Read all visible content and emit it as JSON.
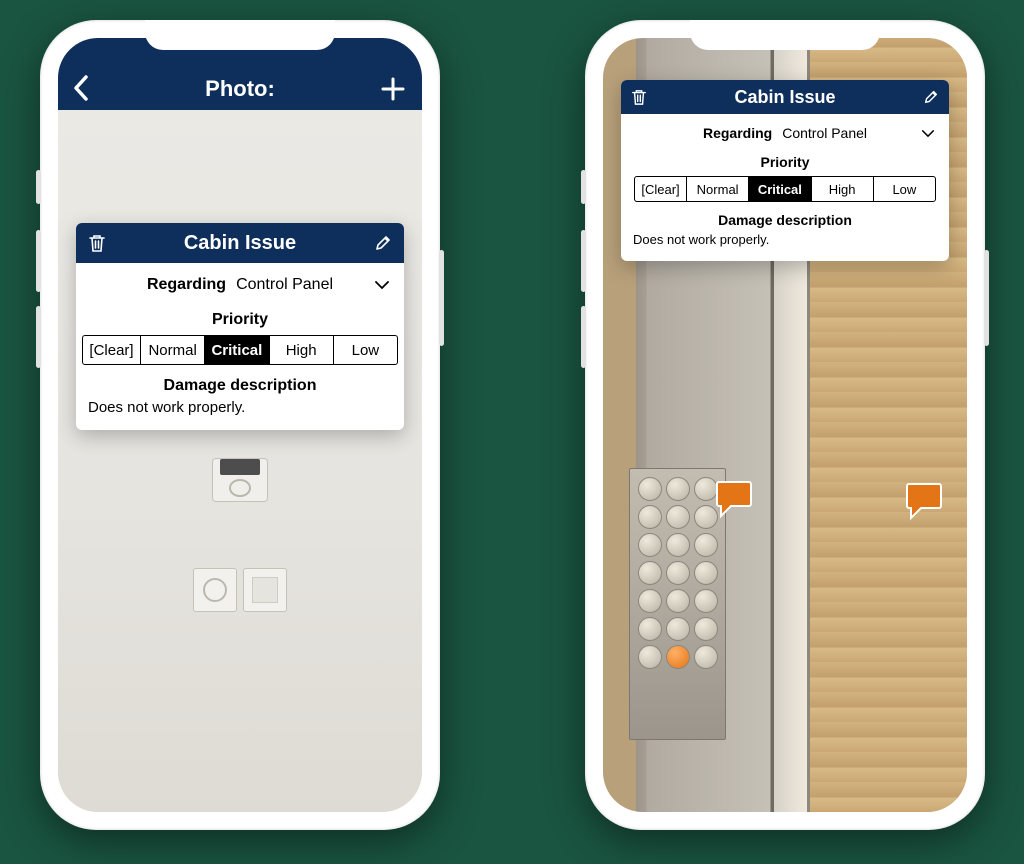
{
  "colors": {
    "navy": "#0e2e5c",
    "accent": "#e37516"
  },
  "header": {
    "title": "Photo:"
  },
  "card": {
    "title": "Cabin Issue",
    "regarding_label": "Regarding",
    "regarding_value": "Control Panel",
    "priority_label": "Priority",
    "priority_options": [
      "[Clear]",
      "Normal",
      "Critical",
      "High",
      "Low"
    ],
    "priority_selected": "Critical",
    "damage_label": "Damage description",
    "damage_text": "Does not work properly."
  }
}
